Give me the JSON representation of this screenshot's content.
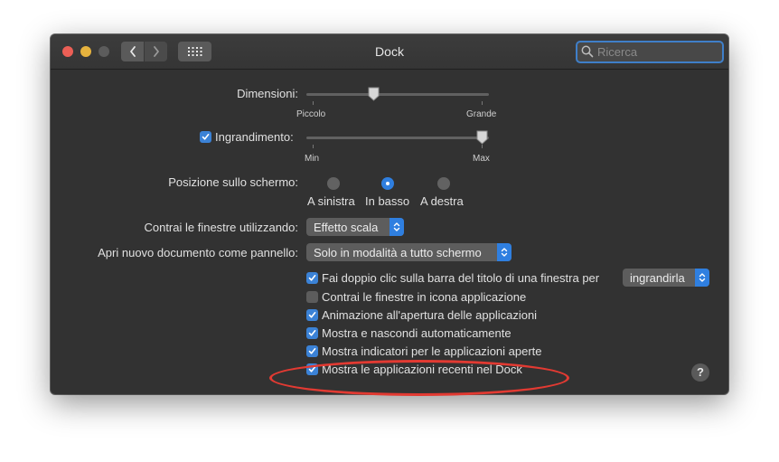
{
  "window": {
    "title": "Dock"
  },
  "search": {
    "placeholder": "Ricerca",
    "value": ""
  },
  "settings": {
    "size": {
      "label": "Dimensioni:",
      "min_label": "Piccolo",
      "max_label": "Grande",
      "value_fraction": 0.37
    },
    "magnification": {
      "label": "Ingrandimento:",
      "checked": true,
      "min_label": "Min",
      "max_label": "Max",
      "value_fraction": 0.97
    },
    "position": {
      "label": "Posizione sullo schermo:",
      "options": [
        "A sinistra",
        "In basso",
        "A destra"
      ],
      "selected": "In basso"
    },
    "minimize_effect": {
      "label": "Contrai le finestre utilizzando:",
      "value": "Effetto scala"
    },
    "prefer_tabs": {
      "label": "Apri nuovo documento come pannello:",
      "value": "Solo in modalità a tutto schermo"
    },
    "double_click": {
      "label": "Fai doppio clic sulla barra del titolo di una finestra per",
      "value": "ingrandirla",
      "checked": true
    },
    "minimize_into_icon": {
      "label": "Contrai le finestre in icona applicazione",
      "checked": false
    },
    "animate_opening": {
      "label": "Animazione all'apertura delle applicazioni",
      "checked": true
    },
    "autohide": {
      "label": "Mostra e nascondi automaticamente",
      "checked": true
    },
    "show_indicators": {
      "label": "Mostra indicatori per le applicazioni aperte",
      "checked": true
    },
    "show_recents": {
      "label": "Mostra le applicazioni recenti nel Dock",
      "checked": true
    }
  },
  "help": {
    "label": "?"
  },
  "colors": {
    "accent": "#2f7fe0",
    "annotation": "#e23a32",
    "background": "#323232"
  }
}
